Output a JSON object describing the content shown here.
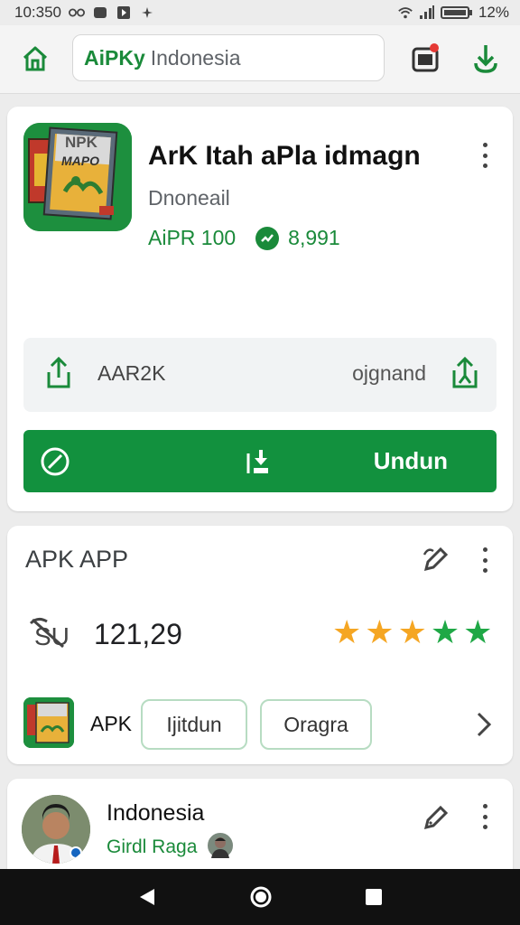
{
  "status_bar": {
    "time": "10:350",
    "battery": "12%"
  },
  "header": {
    "search_brand": "AiPKy",
    "search_query": "Indonesia"
  },
  "app": {
    "icon_text_top": "NPK",
    "icon_text_mid": "MAPO",
    "title": "ArK  Itah aPla idmagn",
    "developer": "Dnoneail",
    "version": "AiPR 100",
    "downloads": "8,991",
    "share_left_label": "AAR2K",
    "share_right_label": "ojgnand",
    "download_label": "Undun"
  },
  "section": {
    "title": "APK APP",
    "rating_value": "121,29",
    "star_count": 5,
    "apk_label": "APK",
    "chip_1": "Ijitdun",
    "chip_2": "Oragra"
  },
  "author": {
    "name": "Indonesia",
    "subtitle": "Girdl Raga"
  },
  "colors": {
    "accent": "#12913e",
    "star_yellow": "#f5a623",
    "star_green": "#1fa846"
  }
}
